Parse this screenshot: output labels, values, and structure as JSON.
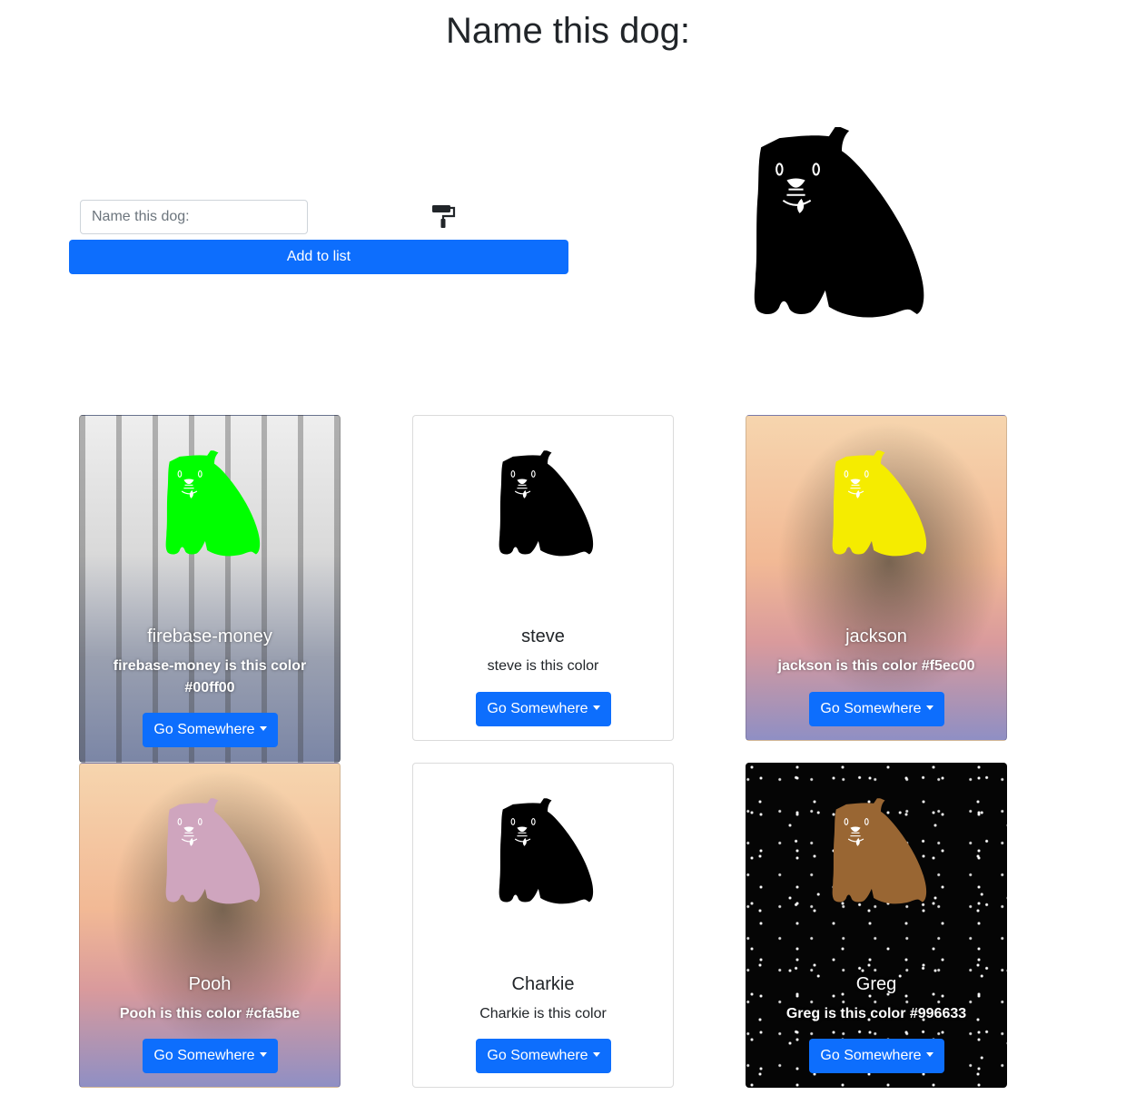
{
  "page": {
    "title": "Name this dog:",
    "input_placeholder": "Name this dog:",
    "add_button_label": "Add to list",
    "hero_dog_color": "#000000"
  },
  "cards": [
    {
      "name": "firebase-money",
      "text": "firebase-money is this color #00ff00",
      "color": "#00ff00",
      "background": "snowy-forest",
      "button_label": "Go Somewhere"
    },
    {
      "name": "steve",
      "text": "steve is this color",
      "color": "#000000",
      "background": "none",
      "button_label": "Go Somewhere"
    },
    {
      "name": "jackson",
      "text": "jackson is this color #f5ec00",
      "color": "#f5ec00",
      "background": "palm-sunset",
      "button_label": "Go Somewhere"
    },
    {
      "name": "Pooh",
      "text": "Pooh is this color #cfa5be",
      "color": "#cfa5be",
      "background": "palm-sunset",
      "button_label": "Go Somewhere"
    },
    {
      "name": "Charkie",
      "text": "Charkie is this color",
      "color": "#000000",
      "background": "none",
      "button_label": "Go Somewhere"
    },
    {
      "name": "Greg",
      "text": "Greg is this color #996633",
      "color": "#996633",
      "background": "starfield",
      "button_label": "Go Somewhere"
    }
  ],
  "icons": {
    "paint_roller": "paint-roller-icon",
    "dropdown": "caret-down-icon"
  },
  "colors": {
    "primary": "#0d6efd"
  }
}
